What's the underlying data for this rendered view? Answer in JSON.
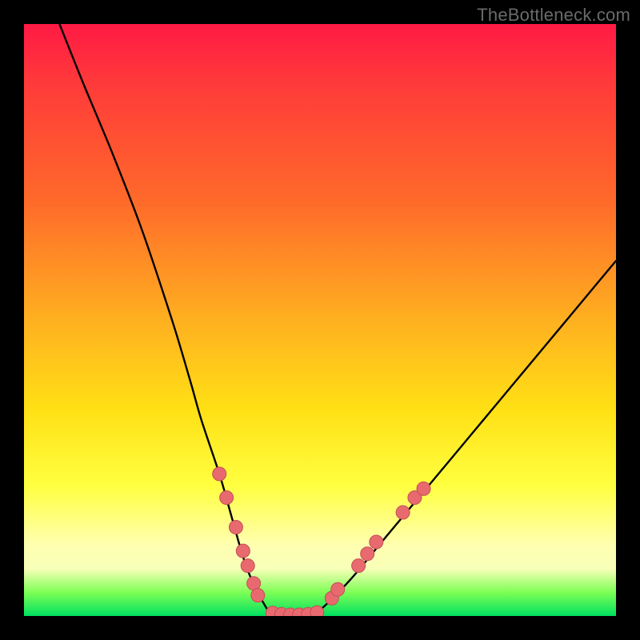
{
  "watermark": "TheBottleneck.com",
  "colors": {
    "frame": "#000000",
    "curve": "#000000",
    "marker_fill": "#e86a6f",
    "marker_stroke": "#c24f55"
  },
  "chart_data": {
    "type": "line",
    "title": "",
    "xlabel": "",
    "ylabel": "",
    "xlim": [
      0,
      100
    ],
    "ylim": [
      0,
      100
    ],
    "grid": false,
    "legend": false,
    "note": "Bottleneck V-curve; y = bottleneck percentage (100 top → 0 bottom), x = relative component performance. Values estimated from pixels.",
    "series": [
      {
        "name": "bottleneck-curve",
        "x": [
          6,
          10,
          15,
          20,
          25,
          28,
          30,
          33,
          35,
          37,
          38.5,
          40,
          42,
          44,
          46,
          48,
          50,
          55,
          60,
          65,
          70,
          75,
          80,
          85,
          90,
          95,
          100
        ],
        "y": [
          100,
          90,
          78,
          65,
          50,
          40,
          33,
          24,
          17,
          10,
          6,
          3,
          0,
          0,
          0,
          0,
          1,
          6,
          12,
          18,
          24,
          30,
          36,
          42,
          48,
          54,
          60
        ]
      }
    ],
    "markers": [
      {
        "x": 33.0,
        "y": 24.0
      },
      {
        "x": 34.2,
        "y": 20.0
      },
      {
        "x": 35.8,
        "y": 15.0
      },
      {
        "x": 37.0,
        "y": 11.0
      },
      {
        "x": 37.8,
        "y": 8.5
      },
      {
        "x": 38.8,
        "y": 5.5
      },
      {
        "x": 39.5,
        "y": 3.5
      },
      {
        "x": 42.0,
        "y": 0.5
      },
      {
        "x": 43.5,
        "y": 0.3
      },
      {
        "x": 45.0,
        "y": 0.2
      },
      {
        "x": 46.5,
        "y": 0.2
      },
      {
        "x": 48.0,
        "y": 0.3
      },
      {
        "x": 49.5,
        "y": 0.6
      },
      {
        "x": 52.0,
        "y": 3.0
      },
      {
        "x": 53.0,
        "y": 4.5
      },
      {
        "x": 56.5,
        "y": 8.5
      },
      {
        "x": 58.0,
        "y": 10.5
      },
      {
        "x": 59.5,
        "y": 12.5
      },
      {
        "x": 64.0,
        "y": 17.5
      },
      {
        "x": 66.0,
        "y": 20.0
      },
      {
        "x": 67.5,
        "y": 21.5
      }
    ]
  }
}
